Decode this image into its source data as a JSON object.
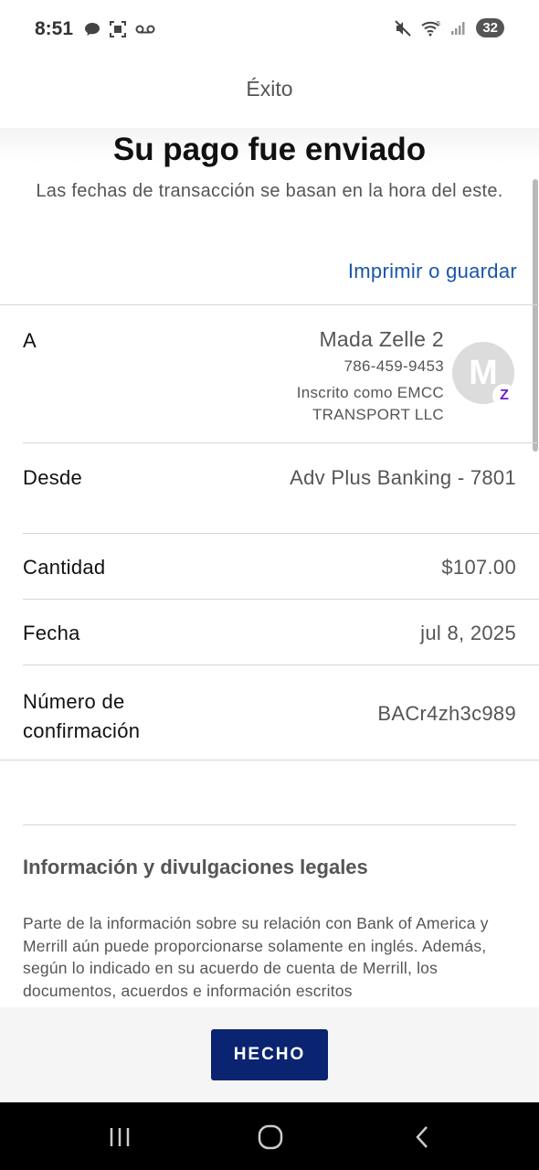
{
  "status_bar": {
    "time": "8:51",
    "battery": "32"
  },
  "header": {
    "title": "Éxito"
  },
  "confirmation": {
    "title": "Su pago fue enviado",
    "subtitle": "Las fechas de transacción se basan en la hora del este.",
    "print_link": "Imprimir o guardar"
  },
  "recipient": {
    "label": "A",
    "name": "Mada Zelle 2",
    "phone": "786-459-9453",
    "enrolled_as": "Inscrito como EMCC TRANSPORT LLC",
    "avatar_initial": "M",
    "badge_glyph": "Z"
  },
  "details": [
    {
      "label": "Desde",
      "value": "Adv Plus Banking - 7801"
    },
    {
      "label": "Cantidad",
      "value": "$107.00"
    },
    {
      "label": "Fecha",
      "value": "jul 8, 2025"
    },
    {
      "label_line1": "Número de",
      "label_line2": "confirmación",
      "value": "BACr4zh3c989"
    }
  ],
  "legal": {
    "heading": "Información y divulgaciones legales",
    "text": "Parte de la información sobre su relación con Bank of America y Merrill aún puede proporcionarse solamente en inglés. Además, según lo indicado en su acuerdo de cuenta de Merrill, los documentos, acuerdos e información escritos"
  },
  "footer": {
    "done_label": "HECHO"
  },
  "colors": {
    "link": "#1a56a8",
    "button": "#0b2471",
    "zelle": "#6d1ed4"
  }
}
